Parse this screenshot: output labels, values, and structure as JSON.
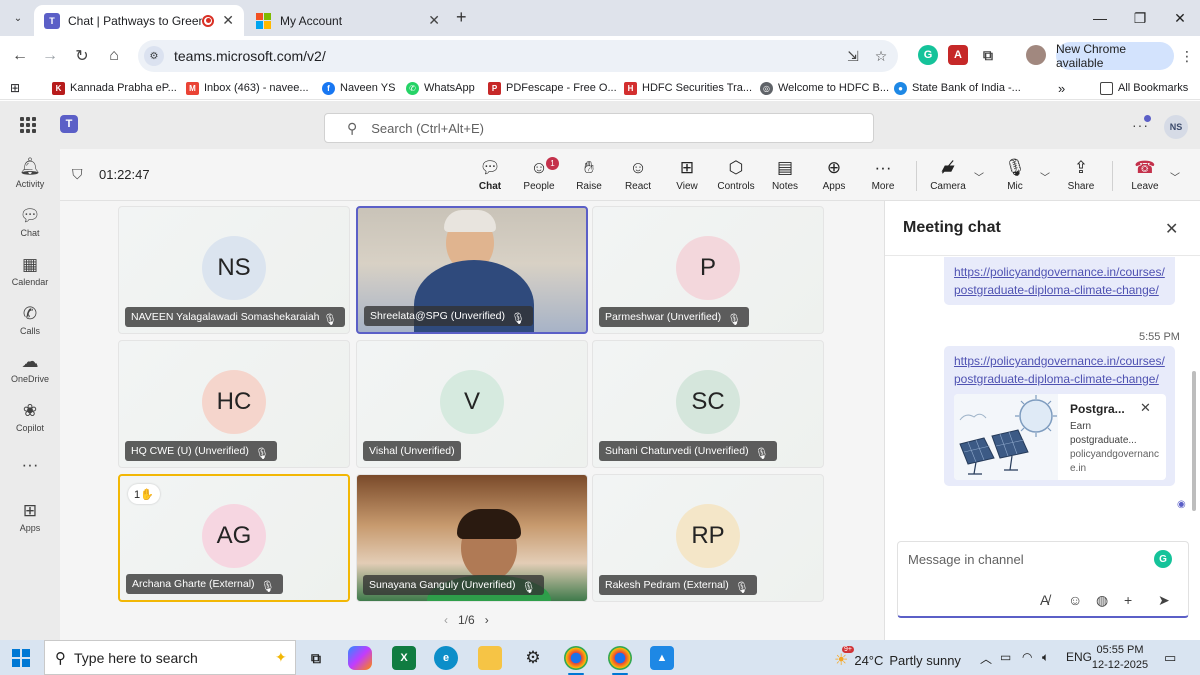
{
  "browser": {
    "tabs": [
      {
        "title": "Chat | Pathways to Green C",
        "active": true,
        "favicon": "teams-icon",
        "recording": true
      },
      {
        "title": "My Account",
        "active": false,
        "favicon": "microsoft-icon"
      }
    ],
    "url": "teams.microsoft.com/v2/",
    "new_chrome_label": "New Chrome available",
    "bookmarks": [
      {
        "label": "Kannada Prabha eP...",
        "icon": "newspaper-icon",
        "color": "#b71c1c"
      },
      {
        "label": "Inbox (463) - navee...",
        "icon": "gmail-icon",
        "color": "#ea4335"
      },
      {
        "label": "Naveen YS",
        "icon": "facebook-icon",
        "color": "#1877f2"
      },
      {
        "label": "WhatsApp",
        "icon": "whatsapp-icon",
        "color": "#25d366"
      },
      {
        "label": "PDFescape - Free O...",
        "icon": "pdfescape-icon",
        "color": "#c62828"
      },
      {
        "label": "HDFC Securities Tra...",
        "icon": "hdfc-icon",
        "color": "#d32f2f"
      },
      {
        "label": "Welcome to HDFC B...",
        "icon": "globe-icon",
        "color": "#5f6368"
      },
      {
        "label": "State Bank of India -...",
        "icon": "sbi-icon",
        "color": "#1e88e5"
      }
    ],
    "all_bookmarks_label": "All Bookmarks"
  },
  "teams": {
    "search_placeholder": "Search (Ctrl+Alt+E)",
    "user_initials": "NS",
    "rail": [
      {
        "label": "Activity",
        "icon": "bell-icon"
      },
      {
        "label": "Chat",
        "icon": "chat-icon"
      },
      {
        "label": "Calendar",
        "icon": "calendar-icon"
      },
      {
        "label": "Calls",
        "icon": "phone-icon"
      },
      {
        "label": "OneDrive",
        "icon": "cloud-icon"
      },
      {
        "label": "Copilot",
        "icon": "copilot-icon"
      },
      {
        "label": "",
        "icon": "more-icon"
      },
      {
        "label": "Apps",
        "icon": "apps-icon"
      }
    ]
  },
  "meeting": {
    "timer": "01:22:47",
    "toolbar": {
      "chat": "Chat",
      "people": "People",
      "people_badge": "1",
      "raise": "Raise",
      "react": "React",
      "view": "View",
      "controls": "Controls",
      "notes": "Notes",
      "apps": "Apps",
      "more": "More",
      "camera": "Camera",
      "mic": "Mic",
      "share": "Share",
      "leave": "Leave"
    },
    "participants": [
      {
        "initials": "NS",
        "name": "NAVEEN Yalagalawadi Somashekaraiah",
        "avatar_bg": "#dbe4ef",
        "video": false
      },
      {
        "initials": "",
        "name": "Shreelata@SPG (Unverified)",
        "avatar_bg": "",
        "video": true,
        "speaking": true
      },
      {
        "initials": "P",
        "name": "Parmeshwar (Unverified)",
        "avatar_bg": "#f3d7dc",
        "video": false
      },
      {
        "initials": "HC",
        "name": "HQ CWE (U) (Unverified)",
        "avatar_bg": "#f5d5cc",
        "video": false
      },
      {
        "initials": "V",
        "name": "Vishal (Unverified)",
        "avatar_bg": "#d6eadf",
        "video": false
      },
      {
        "initials": "SC",
        "name": "Suhani Chaturvedi (Unverified)",
        "avatar_bg": "#d5e6dc",
        "video": false
      },
      {
        "initials": "AG",
        "name": "Archana Gharte (External)",
        "avatar_bg": "#f6d6e1",
        "video": false,
        "hand_raised": "1✋"
      },
      {
        "initials": "",
        "name": "Sunayana Ganguly (Unverified)",
        "avatar_bg": "",
        "video": true
      },
      {
        "initials": "RP",
        "name": "Rakesh Pedram (External)",
        "avatar_bg": "#f4e6c8",
        "video": false
      }
    ],
    "page_indicator": "1/6"
  },
  "chat": {
    "title": "Meeting chat",
    "messages": [
      {
        "link": "https://policyandgovernance.in/courses/postgraduate-diploma-climate-change/",
        "time": ""
      },
      {
        "link": "https://policyandgovernance.in/courses/postgraduate-diploma-climate-change/",
        "time": "5:55 PM"
      }
    ],
    "link_preview": {
      "title": "Postgra...",
      "description": "Earn postgraduate...",
      "domain": "policyandgovernance.in"
    },
    "composer_placeholder": "Message in channel"
  },
  "taskbar": {
    "search_placeholder": "Type here to search",
    "temperature": "24°C",
    "weather": "Partly sunny",
    "language": "ENG",
    "time": "05:55 PM",
    "date": "12-12-2025",
    "weather_badge": "9+"
  }
}
